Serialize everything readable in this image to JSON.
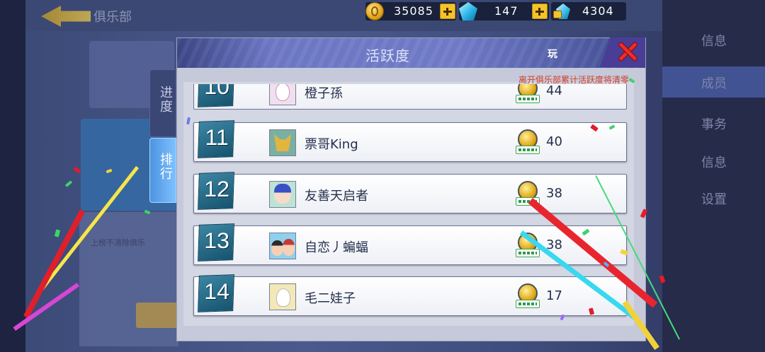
{
  "background": {
    "club_title": "俱乐部",
    "left_info_text": "上榜不清除俱乐",
    "right_menu": [
      "信息",
      "成员",
      "事务",
      "信息",
      "设置"
    ]
  },
  "currency": {
    "coins": "35085",
    "gems": "147",
    "locked_gems": "4304"
  },
  "tabs": {
    "progress": "进度",
    "ranking": "排行"
  },
  "dialog": {
    "title": "活跃度",
    "header_right_cut": "玩",
    "notice": "离开俱乐部累计活跃度将清零"
  },
  "ranking": [
    {
      "rank": "10",
      "name": "橙子孫",
      "activity": "44",
      "avatar": "rabbit-avatar"
    },
    {
      "rank": "11",
      "name": "票哥King",
      "activity": "40",
      "avatar": "fox-avatar"
    },
    {
      "rank": "12",
      "name": "友善天启者",
      "activity": "38",
      "avatar": "blue-hair-avatar"
    },
    {
      "rank": "13",
      "name": "自恋丿蝙蝠",
      "activity": "38",
      "avatar": "duo-avatar"
    },
    {
      "rank": "14",
      "name": "毛二娃子",
      "activity": "17",
      "avatar": "white-pet-avatar"
    }
  ],
  "colors": {
    "dialog_header": "#6b77c4",
    "close_red": "#ec2c2c",
    "notice_red": "#d43f2a",
    "rank_teal": "#2a6f8c",
    "tab_active": "#6fb3f5"
  }
}
